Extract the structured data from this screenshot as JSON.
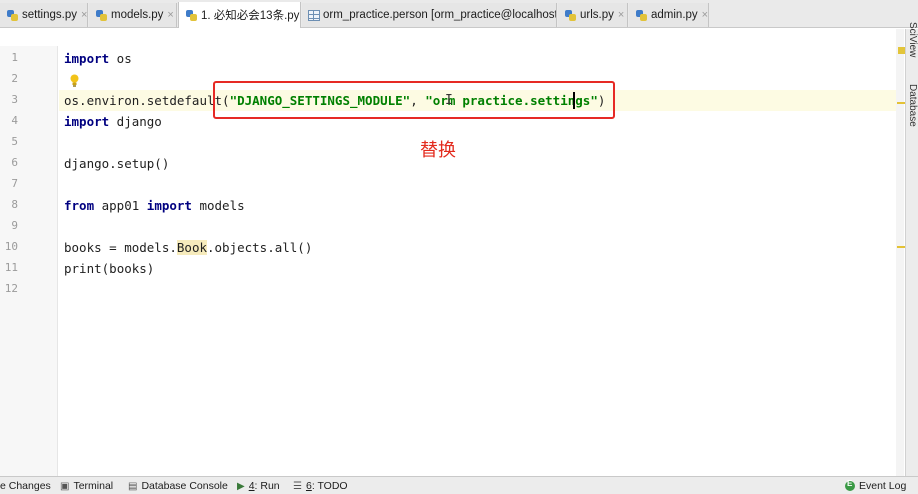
{
  "tabs": [
    {
      "label": "settings.py",
      "icon": "python-file-icon",
      "active": false
    },
    {
      "label": "models.py",
      "icon": "python-file-icon",
      "active": false
    },
    {
      "label": "1. 必知必会13条.py",
      "icon": "python-file-icon",
      "active": true
    },
    {
      "label": "orm_practice.person [orm_practice@localhost]",
      "icon": "table-icon",
      "active": false
    },
    {
      "label": "urls.py",
      "icon": "python-file-icon",
      "active": false
    },
    {
      "label": "admin.py",
      "icon": "python-file-icon",
      "active": false
    }
  ],
  "tab_close_glyph": "×",
  "line_numbers": [
    "1",
    "2",
    "3",
    "4",
    "5",
    "6",
    "7",
    "8",
    "9",
    "10",
    "11",
    "12"
  ],
  "code": {
    "l1_kw": "import",
    "l1_rest": " os",
    "l3_a": "os.environ.setdefaul",
    "l3_b": "t(",
    "l3_s1": "\"DJANGO_SETTINGS_MODULE\"",
    "l3_c": ", ",
    "l3_s2a": "\"orm",
    "l3_s2b": "practice.settings",
    "l3_s2c": "\"",
    "l3_d": ")",
    "l4_kw": "import",
    "l4_rest": " django",
    "l6": "django.setup()",
    "l8_kw1": "from",
    "l8_mid": " app01 ",
    "l8_kw2": "import",
    "l8_rest": " models",
    "l10_a": "books = models.",
    "l10_cls": "Book",
    "l10_b": ".objects.all()",
    "l11_fn": "print",
    "l11_rest": "(books)"
  },
  "annotation": "替换",
  "right_tools": [
    "SciView",
    "Database"
  ],
  "bottom_tools": {
    "changes": "e Changes",
    "terminal": "Terminal",
    "database_console": "Database Console",
    "run_num": "4",
    "run_label": ": Run",
    "todo_num": "6",
    "todo_label": ": TODO",
    "event_log": "Event Log"
  },
  "colors": {
    "accent_annotation": "#e62a25",
    "keyword": "#000080",
    "string": "#008000"
  }
}
